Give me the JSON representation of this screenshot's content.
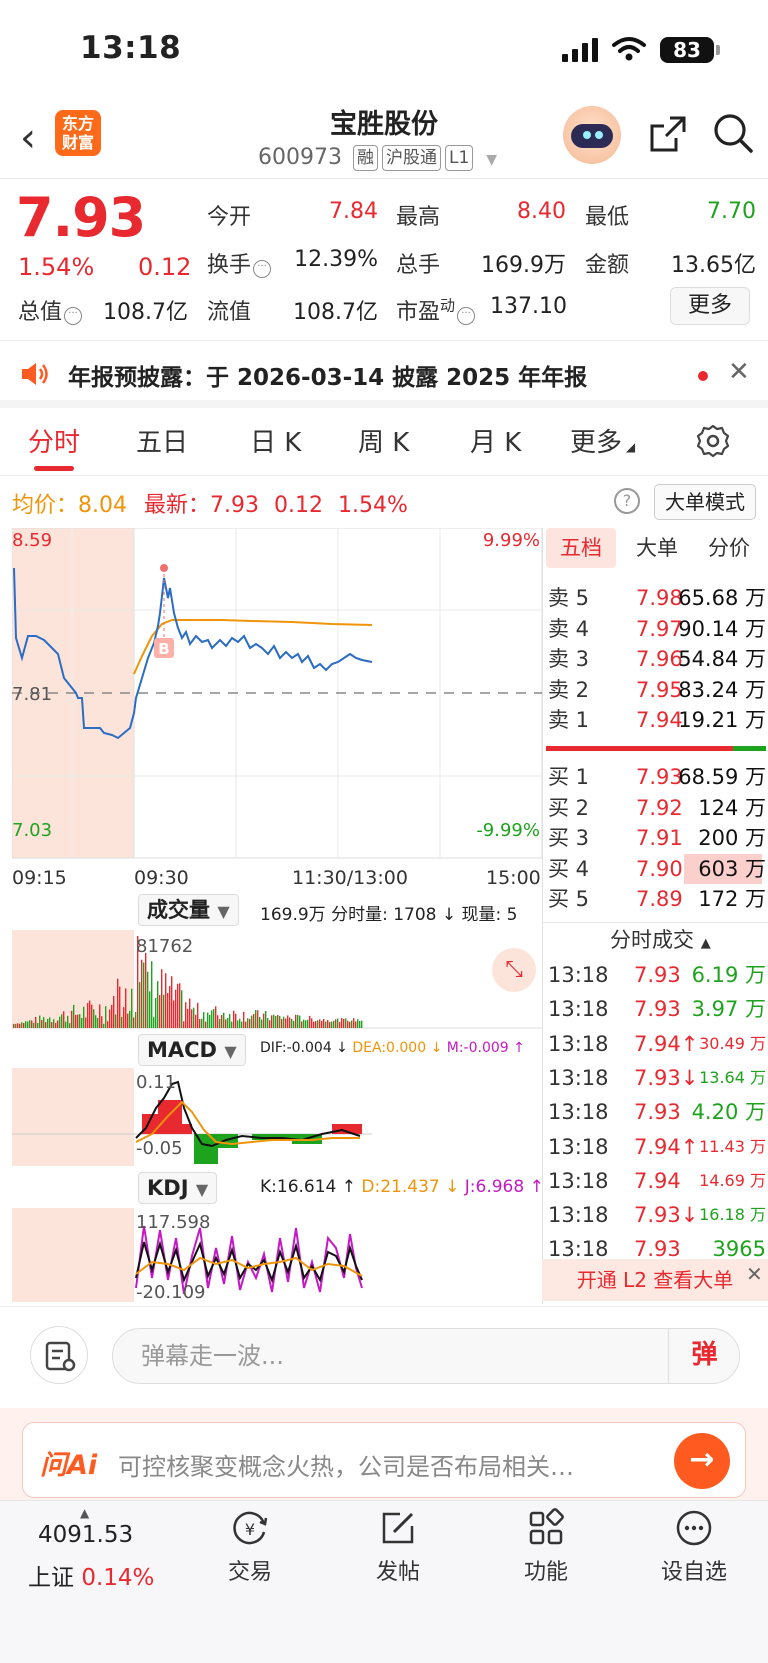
{
  "status": {
    "time": "13:18",
    "battery": "83"
  },
  "header": {
    "title": "宝胜股份",
    "code": "600973",
    "tags": [
      "融",
      "沪股通",
      "L1"
    ],
    "logo": "东方\n财富"
  },
  "quote": {
    "price": "7.93",
    "pct": "1.54%",
    "change": "0.12",
    "fields": [
      {
        "label": "今开",
        "value": "7.84",
        "color": "red"
      },
      {
        "label": "最高",
        "value": "8.40",
        "color": "red"
      },
      {
        "label": "最低",
        "value": "7.70",
        "color": "green"
      },
      {
        "label": "换手",
        "value": "12.39%",
        "color": "dark"
      },
      {
        "label": "总手",
        "value": "169.9万",
        "color": "dark"
      },
      {
        "label": "金额",
        "value": "13.65亿",
        "color": "dark"
      },
      {
        "label": "总值",
        "value": "108.7亿",
        "color": "dark"
      },
      {
        "label": "流值",
        "value": "108.7亿",
        "color": "dark"
      },
      {
        "label": "市盈",
        "sup": "动",
        "value": "137.10",
        "color": "dark"
      }
    ],
    "more": "更多"
  },
  "notice": {
    "text": "年报预披露：于 2026-03-14 披露 2025 年年报"
  },
  "tabs": [
    "分时",
    "五日",
    "日 K",
    "周 K",
    "月 K",
    "更多"
  ],
  "info": {
    "avg_label": "均价：",
    "avg": "8.04",
    "last_label": "最新：",
    "last": "7.93",
    "chg": "0.12",
    "pct": "1.54%",
    "mode_btn": "大单模式"
  },
  "main_chart": {
    "high": "8.59",
    "low": "7.03",
    "base": "7.81",
    "up_pct": "9.99%",
    "down_pct": "-9.99%",
    "times": [
      "09:15",
      "09:30",
      "11:30/13:00",
      "15:00"
    ],
    "marker": "B"
  },
  "volume": {
    "label": "成交量",
    "info": "169.9万 分时量: 1708 ↓ 现量: 5",
    "max": "81762"
  },
  "macd": {
    "label": "MACD",
    "dif": "DIF:-0.004 ↓",
    "dea": "DEA:0.000 ↓",
    "m": "M:-0.009 ↑",
    "top": "0.11",
    "bottom": "-0.05"
  },
  "kdj": {
    "label": "KDJ",
    "k": "K:16.614 ↑",
    "d": "D:21.437 ↓",
    "j": "J:6.968 ↑",
    "top": "117.598",
    "bottom": "-20.109"
  },
  "side": {
    "tabs": [
      "五档",
      "大单",
      "分价"
    ],
    "sell": [
      {
        "label": "卖 5",
        "price": "7.98",
        "vol": "65.68 万"
      },
      {
        "label": "卖 4",
        "price": "7.97",
        "vol": "90.14 万"
      },
      {
        "label": "卖 3",
        "price": "7.96",
        "vol": "54.84 万"
      },
      {
        "label": "卖 2",
        "price": "7.95",
        "vol": "83.24 万"
      },
      {
        "label": "卖 1",
        "price": "7.94",
        "vol": "19.21 万"
      }
    ],
    "buy": [
      {
        "label": "买 1",
        "price": "7.93",
        "vol": "68.59 万"
      },
      {
        "label": "买 2",
        "price": "7.92",
        "vol": "124 万"
      },
      {
        "label": "买 3",
        "price": "7.91",
        "vol": "200 万"
      },
      {
        "label": "买 4",
        "price": "7.90",
        "vol": "603 万"
      },
      {
        "label": "买 5",
        "price": "7.89",
        "vol": "172 万"
      }
    ],
    "trades_title": "分时成交",
    "trades": [
      {
        "time": "13:18",
        "price": "7.93",
        "vol": "6.19 万",
        "color": "green"
      },
      {
        "time": "13:18",
        "price": "7.93",
        "vol": "3.97 万",
        "color": "green"
      },
      {
        "time": "13:18",
        "price": "7.94↑",
        "vol": "30.49 万",
        "color": "red"
      },
      {
        "time": "13:18",
        "price": "7.93↓",
        "vol": "13.64 万",
        "color": "green"
      },
      {
        "time": "13:18",
        "price": "7.93",
        "vol": "4.20 万",
        "color": "green"
      },
      {
        "time": "13:18",
        "price": "7.94↑",
        "vol": "11.43 万",
        "color": "red"
      },
      {
        "time": "13:18",
        "price": "7.94",
        "vol": "14.69 万",
        "color": "red"
      },
      {
        "time": "13:18",
        "price": "7.93↓",
        "vol": "16.18 万",
        "color": "green"
      },
      {
        "time": "13:18",
        "price": "7.93",
        "vol": "3965",
        "color": "green"
      }
    ],
    "l2": "开通 L2 查看大单"
  },
  "danmu": {
    "placeholder": "弹幕走一波...",
    "btn": "弹"
  },
  "ai": {
    "logo": "问Ai",
    "text": "可控核聚变概念火热，公司是否布局相关…"
  },
  "bottom": {
    "index_value": "4091.53",
    "index_name": "上证",
    "index_pct": "0.14%",
    "items": [
      "交易",
      "发帖",
      "功能",
      "设自选"
    ]
  }
}
